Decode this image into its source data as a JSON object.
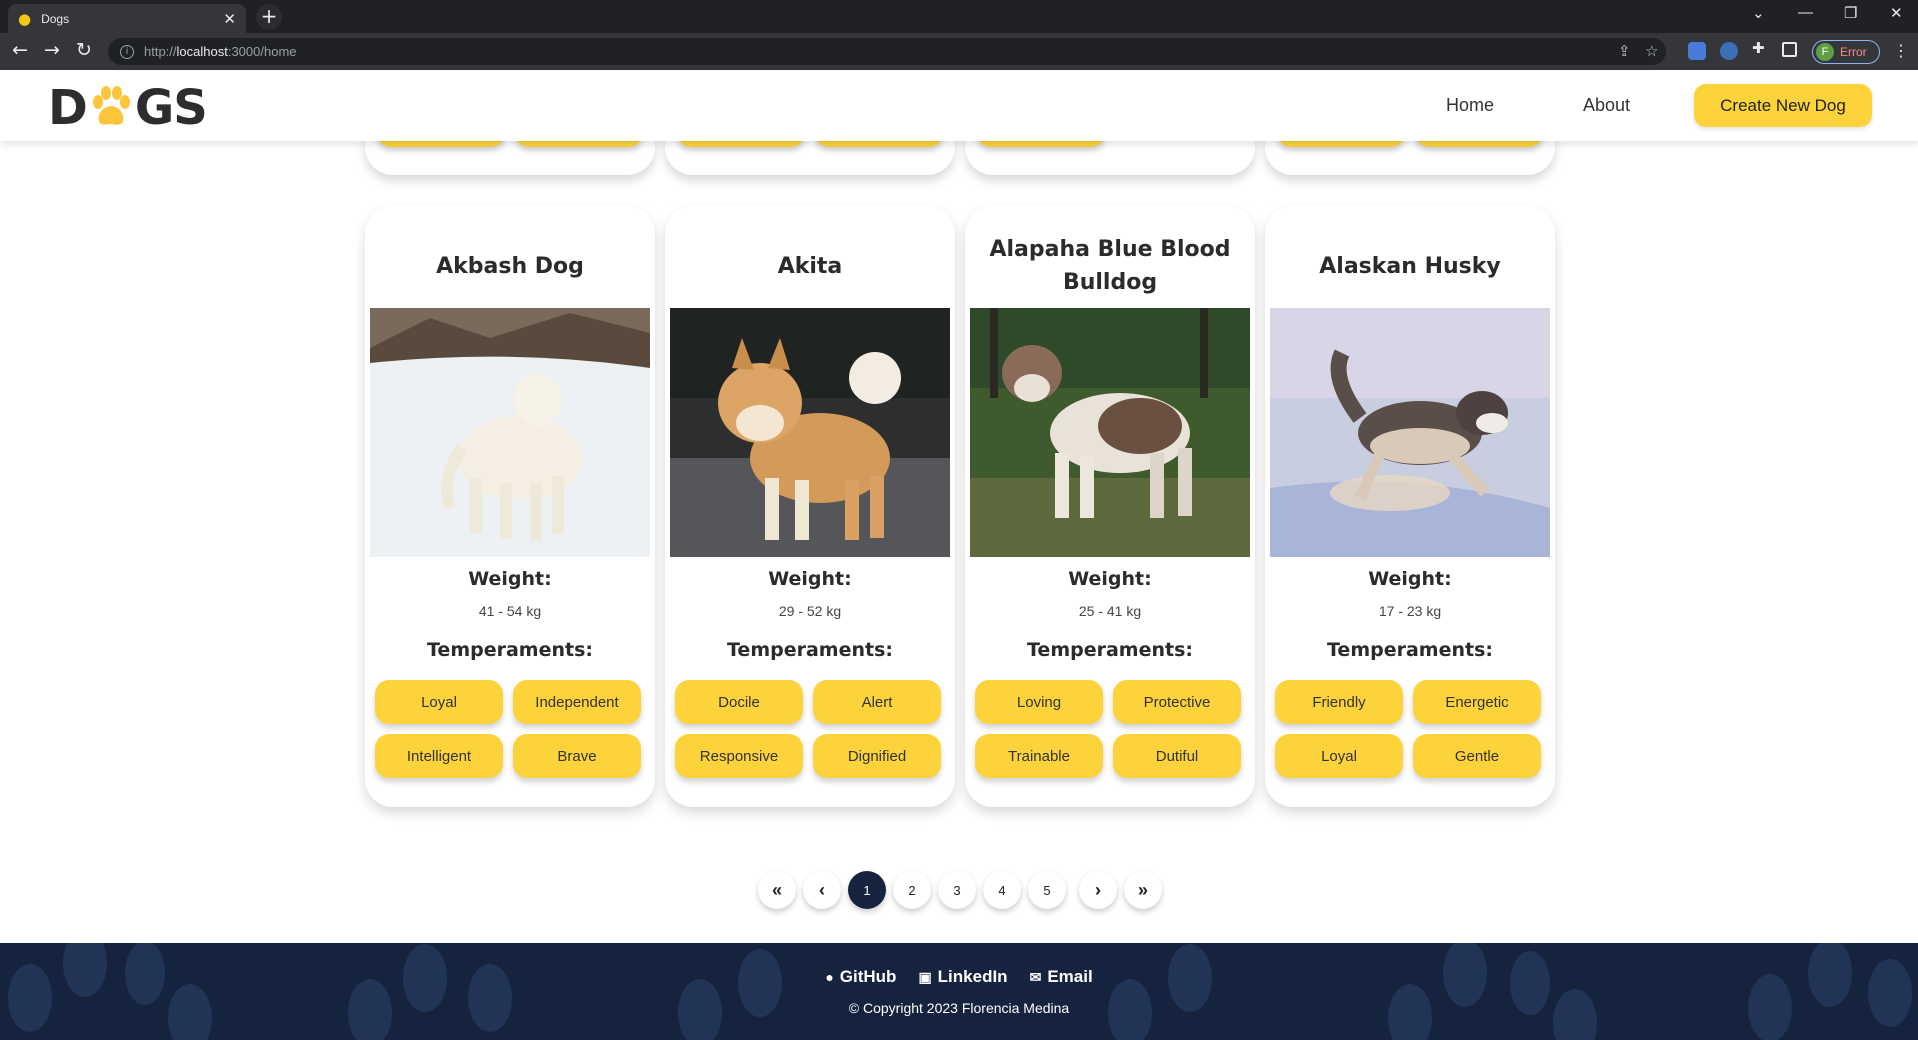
{
  "browser": {
    "tab_title": "Dogs",
    "url_protocol": "http://",
    "url_host": "localhost",
    "url_path": ":3000/home",
    "profile_initial": "F",
    "profile_status": "Error"
  },
  "header": {
    "logo_left": "D",
    "logo_right": "GS",
    "nav": {
      "home": "Home",
      "about": "About"
    },
    "create_button": "Create New Dog",
    "accent_color": "#fdd33b"
  },
  "cards": [
    {
      "name": "Akbash Dog",
      "image": "white dog standing in snow",
      "weight_label": "Weight:",
      "weight": "41 - 54 kg",
      "temperaments_label": "Temperaments:",
      "temperaments": [
        "Loyal",
        "Independent",
        "Intelligent",
        "Brave"
      ]
    },
    {
      "name": "Akita",
      "image": "orange and white akita standing",
      "weight_label": "Weight:",
      "weight": "29 - 52 kg",
      "temperaments_label": "Temperaments:",
      "temperaments": [
        "Docile",
        "Alert",
        "Responsive",
        "Dignified"
      ]
    },
    {
      "name": "Alapaha Blue Blood Bulldog",
      "image": "bulldog standing on grass",
      "weight_label": "Weight:",
      "weight": "25 - 41 kg",
      "temperaments_label": "Temperaments:",
      "temperaments": [
        "Loving",
        "Protective",
        "Trainable",
        "Dutiful"
      ]
    },
    {
      "name": "Alaskan Husky",
      "image": "husky running through snow",
      "weight_label": "Weight:",
      "weight": "17 - 23 kg",
      "temperaments_label": "Temperaments:",
      "temperaments": [
        "Friendly",
        "Energetic",
        "Loyal",
        "Gentle"
      ]
    }
  ],
  "pagination": {
    "first_icon": "double-chevron-left-icon",
    "prev_icon": "chevron-left-icon",
    "pages": [
      "1",
      "2",
      "3",
      "4",
      "5"
    ],
    "active_page": "1",
    "next_icon": "chevron-right-icon",
    "last_icon": "double-chevron-right-icon"
  },
  "footer": {
    "links": {
      "github": "GitHub",
      "linkedin": "LinkedIn",
      "email": "Email"
    },
    "copyright": "© Copyright 2023 Florencia Medina",
    "background_color": "#15233f"
  }
}
